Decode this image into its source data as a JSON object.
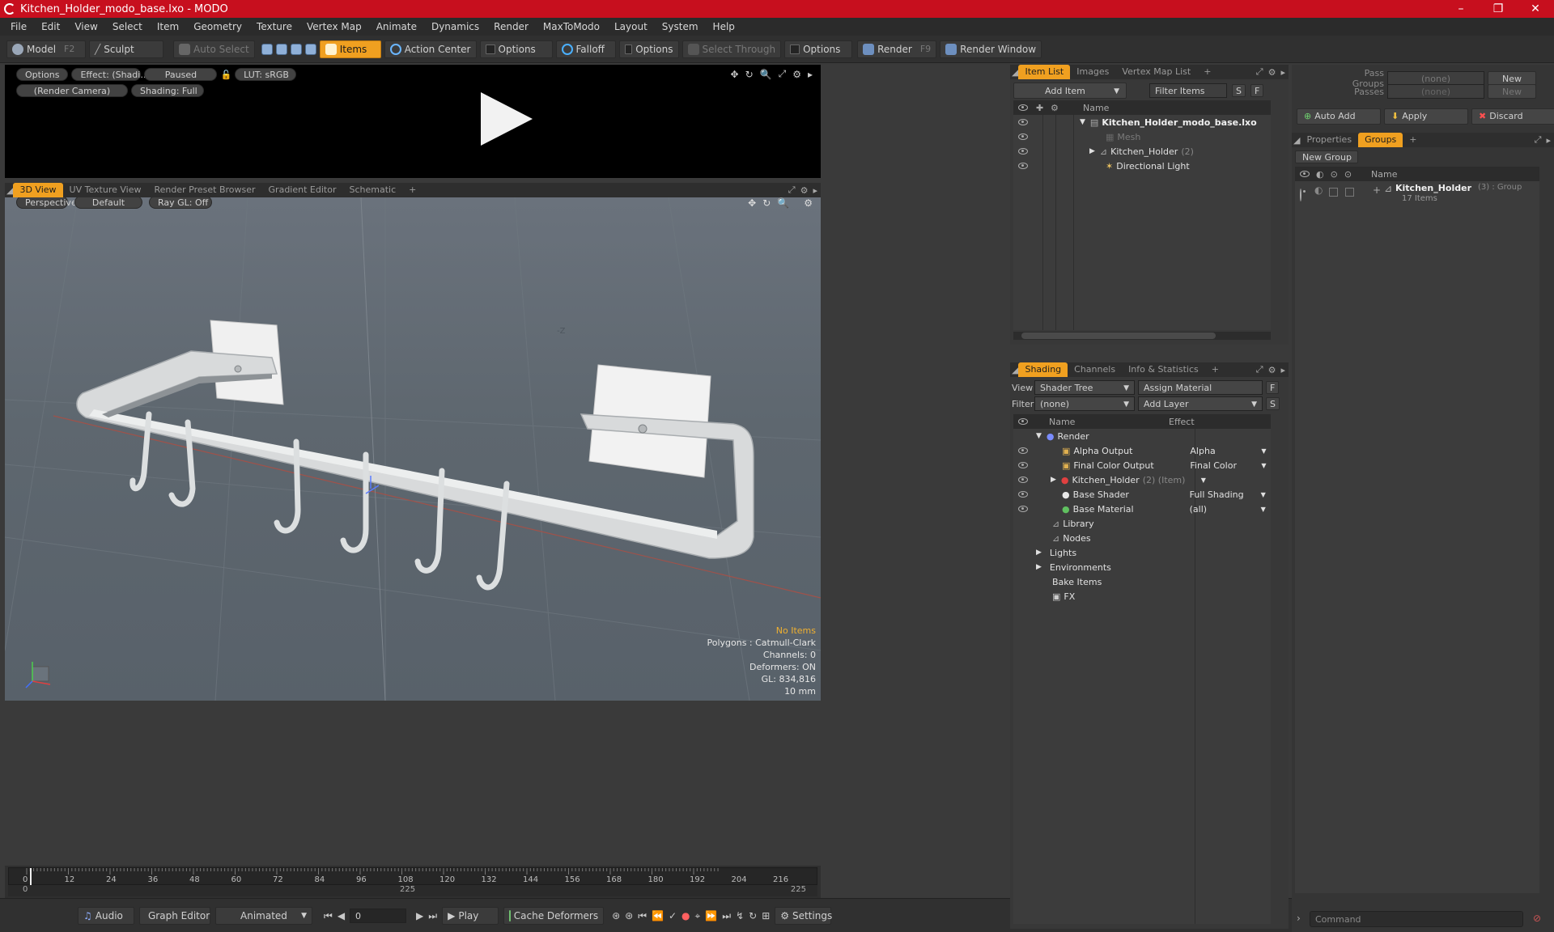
{
  "window": {
    "title": "Kitchen_Holder_modo_base.lxo - MODO",
    "minimize": "–",
    "maximize": "❐",
    "close": "✕"
  },
  "menu": [
    "File",
    "Edit",
    "View",
    "Select",
    "Item",
    "Geometry",
    "Texture",
    "Vertex Map",
    "Animate",
    "Dynamics",
    "Render",
    "MaxToModo",
    "Layout",
    "System",
    "Help"
  ],
  "toolbar": {
    "model": "Model",
    "model_key": "F2",
    "sculpt": "Sculpt",
    "auto_select": "Auto Select",
    "items": "Items",
    "action_center": "Action Center",
    "options1": "Options",
    "falloff": "Falloff",
    "options2": "Options",
    "select_through": "Select Through",
    "options3": "Options",
    "render": "Render",
    "render_key": "F9",
    "render_window": "Render Window"
  },
  "preview": {
    "options": "Options",
    "effect": "Effect: (Shadi...",
    "paused": "Paused",
    "lut": "LUT: sRGB",
    "camera": "(Render Camera)",
    "shading": "Shading: Full"
  },
  "view_tabs": [
    "3D View",
    "UV Texture View",
    "Render Preset Browser",
    "Gradient Editor",
    "Schematic"
  ],
  "viewport": {
    "perspective": "Perspective",
    "default": "Default",
    "raygl": "Ray GL: Off",
    "axis_label": "-Z",
    "info": {
      "no_items": "No Items",
      "polygons": "Polygons : Catmull-Clark",
      "channels": "Channels: 0",
      "deformers": "Deformers: ON",
      "gl": "GL: 834,816",
      "scale": "10 mm"
    }
  },
  "timeline": {
    "ticks": [
      "0",
      "12",
      "24",
      "36",
      "48",
      "60",
      "72",
      "84",
      "96",
      "108",
      "120",
      "132",
      "144",
      "156",
      "168",
      "180",
      "192",
      "204",
      "216"
    ],
    "sub_left": "0",
    "sub_mid": "225",
    "sub_right": "225"
  },
  "bottom": {
    "audio": "Audio",
    "graph_editor": "Graph Editor",
    "animated": "Animated",
    "frame": "0",
    "play": "Play",
    "cache": "Cache Deformers",
    "settings": "Settings"
  },
  "item_list": {
    "tabs": [
      "Item List",
      "Images",
      "Vertex Map List"
    ],
    "add_item": "Add Item",
    "filter": "Filter Items",
    "s": "S",
    "f": "F",
    "col_name": "Name",
    "rows": [
      {
        "name": "Kitchen_Holder_modo_base.lxo",
        "extra": ""
      },
      {
        "name": "Mesh",
        "extra": ""
      },
      {
        "name": "Kitchen_Holder",
        "extra": "(2)"
      },
      {
        "name": "Directional Light",
        "extra": ""
      }
    ]
  },
  "shading": {
    "tabs": [
      "Shading",
      "Channels",
      "Info & Statistics"
    ],
    "view_label": "View",
    "view_value": "Shader Tree",
    "assign": "Assign Material",
    "f": "F",
    "filter_label": "Filter",
    "filter_value": "(none)",
    "add_layer": "Add Layer",
    "s": "S",
    "col_name": "Name",
    "col_effect": "Effect",
    "rows": [
      {
        "name": "Render",
        "extra": "",
        "effect": ""
      },
      {
        "name": "Alpha Output",
        "extra": "",
        "effect": "Alpha"
      },
      {
        "name": "Final Color Output",
        "extra": "",
        "effect": "Final Color"
      },
      {
        "name": "Kitchen_Holder",
        "extra": "(2) (Item)",
        "effect": ""
      },
      {
        "name": "Base Shader",
        "extra": "",
        "effect": "Full Shading"
      },
      {
        "name": "Base Material",
        "extra": "",
        "effect": "(all)"
      },
      {
        "name": "Library",
        "extra": "",
        "effect": ""
      },
      {
        "name": "Nodes",
        "extra": "",
        "effect": ""
      },
      {
        "name": "Lights",
        "extra": "",
        "effect": ""
      },
      {
        "name": "Environments",
        "extra": "",
        "effect": ""
      },
      {
        "name": "Bake Items",
        "extra": "",
        "effect": ""
      },
      {
        "name": "FX",
        "extra": "",
        "effect": ""
      }
    ]
  },
  "right": {
    "pass_groups": "Pass Groups",
    "passes": "Passes",
    "none": "(none)",
    "new": "New",
    "auto_add": "Auto Add",
    "apply": "Apply",
    "discard": "Discard",
    "tabs": [
      "Properties",
      "Groups"
    ],
    "new_group": "New Group",
    "col_name": "Name",
    "group_name": "Kitchen_Holder",
    "group_extra": "(3) : Group",
    "group_items": "17 Items",
    "command": "Command"
  }
}
